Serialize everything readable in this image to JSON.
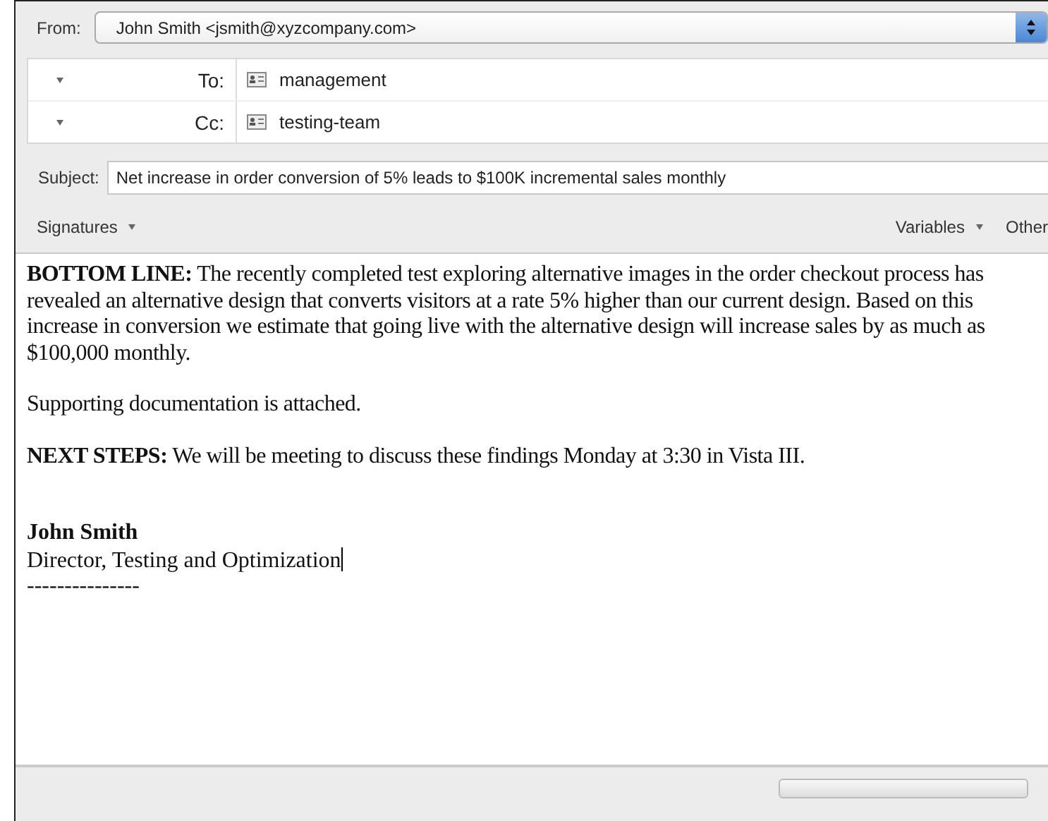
{
  "from": {
    "label": "From:",
    "value": "John Smith <jsmith@xyzcompany.com>"
  },
  "recipients": [
    {
      "label": "To:",
      "value": "management"
    },
    {
      "label": "Cc:",
      "value": "testing-team"
    }
  ],
  "subject": {
    "label": "Subject:",
    "value": "Net increase in order conversion of 5% leads to $100K incremental sales monthly"
  },
  "toolbar": {
    "left": [
      "Signatures"
    ],
    "right": [
      "Variables",
      "Other"
    ]
  },
  "body": {
    "paragraphs": [
      "**BOTTOM LINE:** The recently completed test exploring alternative images in the order checkout process has revealed an alternative design that converts visitors at a rate 5% higher than our current design.  Based on this increase in conversion we estimate that going live with the alternative design will increase sales by as much as $100,000 monthly.",
      "Supporting documentation is attached.",
      "**NEXT STEPS:** We will be meeting to discuss these findings Monday at 3:30 in Vista III."
    ],
    "signature": {
      "name": "John Smith",
      "title": "Director, Testing and Optimization",
      "rule": "---------------"
    }
  }
}
